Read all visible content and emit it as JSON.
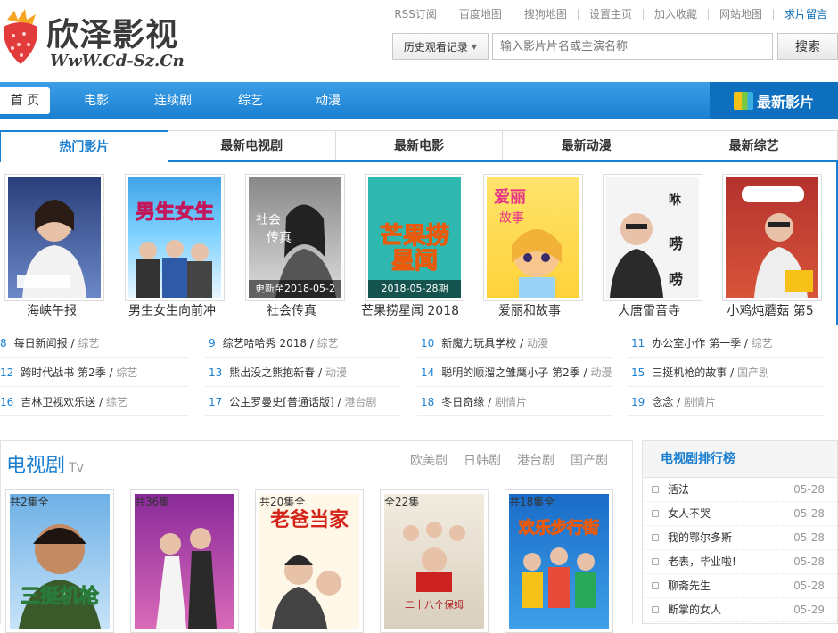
{
  "header": {
    "logo_cn": "欣泽影视",
    "logo_url": "WwW.Cd-Sz.Cn",
    "top_links": [
      {
        "label": "RSS订阅"
      },
      {
        "label": "百度地图"
      },
      {
        "label": "搜狗地图"
      },
      {
        "label": "设置主页"
      },
      {
        "label": "加入收藏"
      },
      {
        "label": "网站地图"
      },
      {
        "label": "求片留言"
      }
    ],
    "history_label": "历史观看记录",
    "search_placeholder": "输入影片片名或主演名称",
    "search_button": "搜索"
  },
  "nav": {
    "home": "首 页",
    "items": [
      "电影",
      "连续剧",
      "综艺",
      "动漫"
    ],
    "newest": "最新影片"
  },
  "tabs": [
    "热门影片",
    "最新电视剧",
    "最新电影",
    "最新动漫",
    "最新综艺"
  ],
  "hot": [
    {
      "title": "海峡午报",
      "caption": ""
    },
    {
      "title": "男生女生向前冲",
      "caption": ""
    },
    {
      "title": "社会传真",
      "caption": "更新至2018-05-2"
    },
    {
      "title": "芒果捞星闻 2018",
      "caption": "2018-05-28期"
    },
    {
      "title": "爱丽和故事",
      "caption": ""
    },
    {
      "title": "大唐雷音寺",
      "caption": ""
    },
    {
      "title": "小鸡炖蘑菇 第5",
      "caption": ""
    }
  ],
  "ranking": [
    [
      {
        "n": "8",
        "title": "每日新闻报",
        "tag": "综艺"
      },
      {
        "n": "12",
        "title": "跨时代战书 第2季",
        "tag": "综艺"
      },
      {
        "n": "16",
        "title": "吉林卫视欢乐送",
        "tag": "综艺"
      }
    ],
    [
      {
        "n": "9",
        "title": "综艺哈哈秀 2018",
        "tag": "综艺"
      },
      {
        "n": "13",
        "title": "熊出没之熊抱新春",
        "tag": "动漫"
      },
      {
        "n": "17",
        "title": "公主罗曼史[普通话版]",
        "tag": "港台剧"
      }
    ],
    [
      {
        "n": "10",
        "title": "新魔力玩具学校",
        "tag": "动漫"
      },
      {
        "n": "14",
        "title": "聪明的顺溜之雏鹰小子 第2季",
        "tag": "动漫"
      },
      {
        "n": "18",
        "title": "冬日奇缘",
        "tag": "剧情片"
      }
    ],
    [
      {
        "n": "11",
        "title": "办公室小作 第一季",
        "tag": "综艺"
      },
      {
        "n": "15",
        "title": "三挺机枪的故事",
        "tag": "国产剧"
      },
      {
        "n": "19",
        "title": "念念",
        "tag": "剧情片"
      }
    ]
  ],
  "tv": {
    "title": "电视剧",
    "subtitle": "Tv",
    "categories": [
      "欧美剧",
      "日韩剧",
      "港台剧",
      "国产剧"
    ],
    "posters": [
      {
        "caption": "共2集全",
        "art": "三挺机枪"
      },
      {
        "caption": "共36集",
        "art": ""
      },
      {
        "caption": "共20集全",
        "art": "老爸当家"
      },
      {
        "caption": "全22集",
        "art": "二十八个保姆"
      },
      {
        "caption": "共18集全",
        "art": "欢乐步行街"
      }
    ]
  },
  "tv_rank": {
    "title": "电视剧排行榜",
    "items": [
      {
        "title": "活法",
        "date": "05-28"
      },
      {
        "title": "女人不哭",
        "date": "05-28"
      },
      {
        "title": "我的鄂尔多斯",
        "date": "05-28"
      },
      {
        "title": "老表，毕业啦!",
        "date": "05-28"
      },
      {
        "title": "聊斋先生",
        "date": "05-28"
      },
      {
        "title": "断掌的女人",
        "date": "05-29"
      }
    ]
  },
  "colors": {
    "brand": "#1a7fd1",
    "nav_dark": "#0f6fbf"
  }
}
